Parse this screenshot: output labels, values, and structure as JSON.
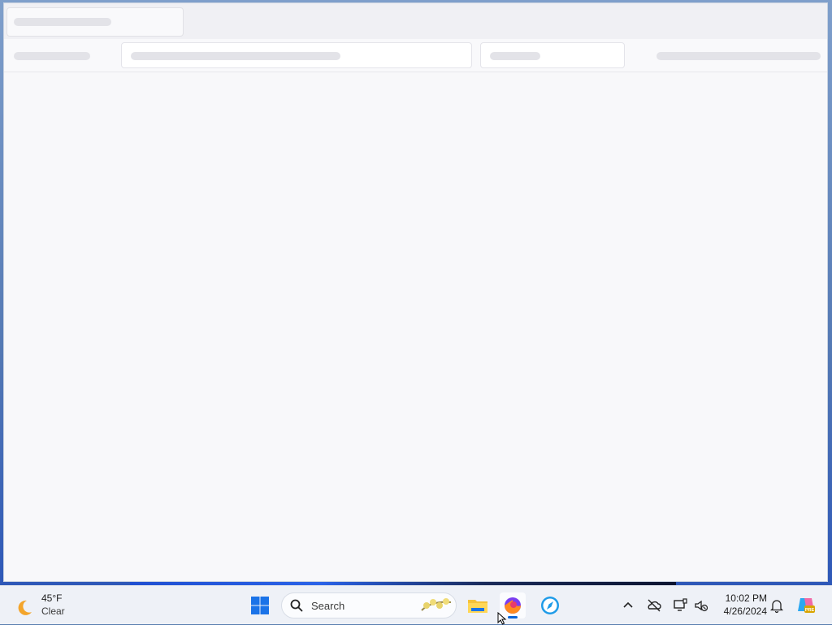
{
  "taskbar": {
    "weather": {
      "temperature": "45°F",
      "condition": "Clear",
      "icon": "moon-icon"
    },
    "search": {
      "label": "Search"
    },
    "apps": [
      {
        "name": "File Explorer",
        "icon": "folder-icon"
      },
      {
        "name": "Firefox",
        "icon": "firefox-icon"
      },
      {
        "name": "Edge/Browser",
        "icon": "compass-icon"
      }
    ],
    "clock": {
      "time": "10:02 PM",
      "date": "4/26/2024"
    }
  },
  "colors": {
    "accent": "#0a64d6",
    "window_bg": "#f8f8fa",
    "taskbar_bg": "#eef1f7",
    "skeleton": "#e3e3e8"
  }
}
